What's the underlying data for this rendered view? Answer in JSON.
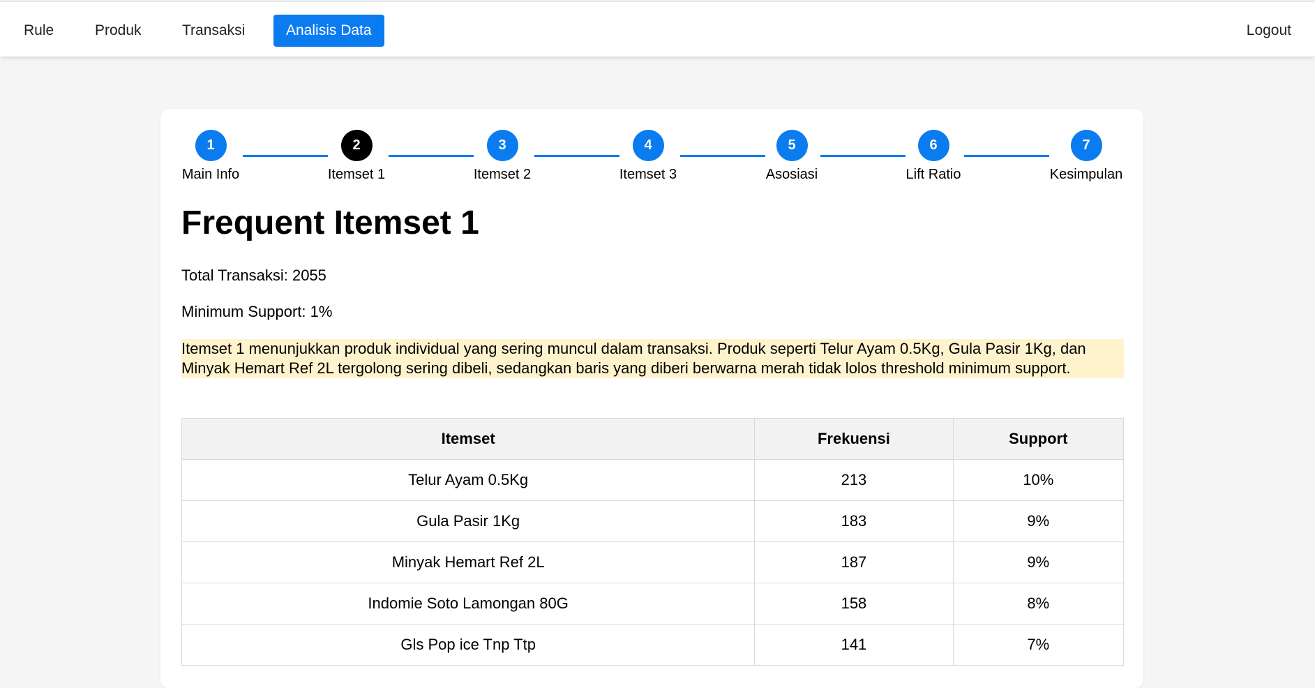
{
  "nav": {
    "rule": "Rule",
    "produk": "Produk",
    "transaksi": "Transaksi",
    "analisis": "Analisis Data",
    "logout": "Logout"
  },
  "stepper": [
    {
      "num": "1",
      "label": "Main Info"
    },
    {
      "num": "2",
      "label": "Itemset 1"
    },
    {
      "num": "3",
      "label": "Itemset 2"
    },
    {
      "num": "4",
      "label": "Itemset 3"
    },
    {
      "num": "5",
      "label": "Asosiasi"
    },
    {
      "num": "6",
      "label": "Lift Ratio"
    },
    {
      "num": "7",
      "label": "Kesimpulan"
    }
  ],
  "page": {
    "title": "Frequent Itemset 1",
    "total": "Total Transaksi: 2055",
    "min_support": "Minimum Support: 1%",
    "note": "Itemset 1 menunjukkan produk individual yang sering muncul dalam transaksi. Produk seperti Telur Ayam 0.5Kg, Gula Pasir 1Kg, dan Minyak Hemart Ref 2L tergolong sering dibeli, sedangkan baris yang diberi berwarna merah tidak lolos threshold minimum support."
  },
  "table": {
    "headers": [
      "Itemset",
      "Frekuensi",
      "Support"
    ],
    "rows": [
      [
        "Telur Ayam 0.5Kg",
        "213",
        "10%"
      ],
      [
        "Gula Pasir 1Kg",
        "183",
        "9%"
      ],
      [
        "Minyak Hemart Ref 2L",
        "187",
        "9%"
      ],
      [
        "Indomie Soto Lamongan 80G",
        "158",
        "8%"
      ],
      [
        "Gls Pop ice Tnp Ttp",
        "141",
        "7%"
      ]
    ]
  },
  "colors": {
    "accent": "#0a7cf0",
    "current_step": "#000000",
    "note_bg": "#fff3cd"
  }
}
